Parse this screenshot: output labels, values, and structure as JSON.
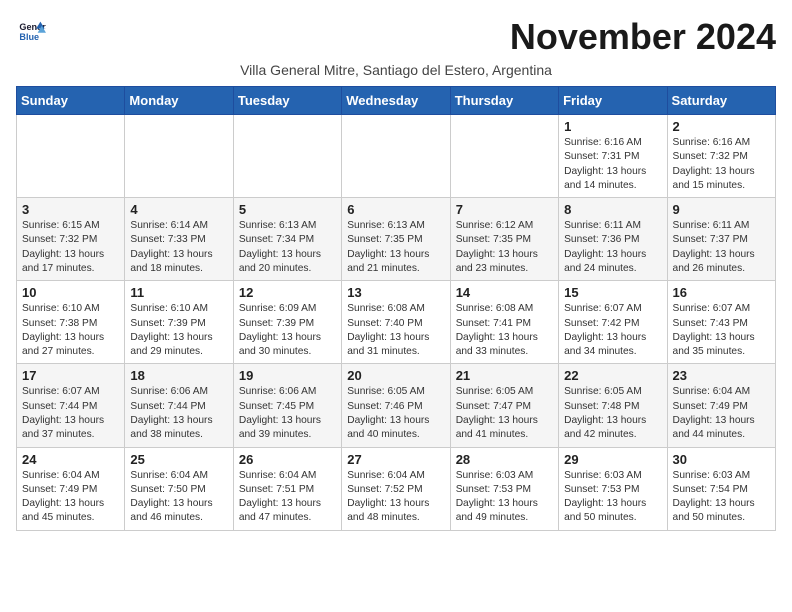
{
  "logo": {
    "line1": "General",
    "line2": "Blue"
  },
  "title": "November 2024",
  "subtitle": "Villa General Mitre, Santiago del Estero, Argentina",
  "days_of_week": [
    "Sunday",
    "Monday",
    "Tuesday",
    "Wednesday",
    "Thursday",
    "Friday",
    "Saturday"
  ],
  "weeks": [
    [
      {
        "day": "",
        "info": ""
      },
      {
        "day": "",
        "info": ""
      },
      {
        "day": "",
        "info": ""
      },
      {
        "day": "",
        "info": ""
      },
      {
        "day": "",
        "info": ""
      },
      {
        "day": "1",
        "info": "Sunrise: 6:16 AM\nSunset: 7:31 PM\nDaylight: 13 hours and 14 minutes."
      },
      {
        "day": "2",
        "info": "Sunrise: 6:16 AM\nSunset: 7:32 PM\nDaylight: 13 hours and 15 minutes."
      }
    ],
    [
      {
        "day": "3",
        "info": "Sunrise: 6:15 AM\nSunset: 7:32 PM\nDaylight: 13 hours and 17 minutes."
      },
      {
        "day": "4",
        "info": "Sunrise: 6:14 AM\nSunset: 7:33 PM\nDaylight: 13 hours and 18 minutes."
      },
      {
        "day": "5",
        "info": "Sunrise: 6:13 AM\nSunset: 7:34 PM\nDaylight: 13 hours and 20 minutes."
      },
      {
        "day": "6",
        "info": "Sunrise: 6:13 AM\nSunset: 7:35 PM\nDaylight: 13 hours and 21 minutes."
      },
      {
        "day": "7",
        "info": "Sunrise: 6:12 AM\nSunset: 7:35 PM\nDaylight: 13 hours and 23 minutes."
      },
      {
        "day": "8",
        "info": "Sunrise: 6:11 AM\nSunset: 7:36 PM\nDaylight: 13 hours and 24 minutes."
      },
      {
        "day": "9",
        "info": "Sunrise: 6:11 AM\nSunset: 7:37 PM\nDaylight: 13 hours and 26 minutes."
      }
    ],
    [
      {
        "day": "10",
        "info": "Sunrise: 6:10 AM\nSunset: 7:38 PM\nDaylight: 13 hours and 27 minutes."
      },
      {
        "day": "11",
        "info": "Sunrise: 6:10 AM\nSunset: 7:39 PM\nDaylight: 13 hours and 29 minutes."
      },
      {
        "day": "12",
        "info": "Sunrise: 6:09 AM\nSunset: 7:39 PM\nDaylight: 13 hours and 30 minutes."
      },
      {
        "day": "13",
        "info": "Sunrise: 6:08 AM\nSunset: 7:40 PM\nDaylight: 13 hours and 31 minutes."
      },
      {
        "day": "14",
        "info": "Sunrise: 6:08 AM\nSunset: 7:41 PM\nDaylight: 13 hours and 33 minutes."
      },
      {
        "day": "15",
        "info": "Sunrise: 6:07 AM\nSunset: 7:42 PM\nDaylight: 13 hours and 34 minutes."
      },
      {
        "day": "16",
        "info": "Sunrise: 6:07 AM\nSunset: 7:43 PM\nDaylight: 13 hours and 35 minutes."
      }
    ],
    [
      {
        "day": "17",
        "info": "Sunrise: 6:07 AM\nSunset: 7:44 PM\nDaylight: 13 hours and 37 minutes."
      },
      {
        "day": "18",
        "info": "Sunrise: 6:06 AM\nSunset: 7:44 PM\nDaylight: 13 hours and 38 minutes."
      },
      {
        "day": "19",
        "info": "Sunrise: 6:06 AM\nSunset: 7:45 PM\nDaylight: 13 hours and 39 minutes."
      },
      {
        "day": "20",
        "info": "Sunrise: 6:05 AM\nSunset: 7:46 PM\nDaylight: 13 hours and 40 minutes."
      },
      {
        "day": "21",
        "info": "Sunrise: 6:05 AM\nSunset: 7:47 PM\nDaylight: 13 hours and 41 minutes."
      },
      {
        "day": "22",
        "info": "Sunrise: 6:05 AM\nSunset: 7:48 PM\nDaylight: 13 hours and 42 minutes."
      },
      {
        "day": "23",
        "info": "Sunrise: 6:04 AM\nSunset: 7:49 PM\nDaylight: 13 hours and 44 minutes."
      }
    ],
    [
      {
        "day": "24",
        "info": "Sunrise: 6:04 AM\nSunset: 7:49 PM\nDaylight: 13 hours and 45 minutes."
      },
      {
        "day": "25",
        "info": "Sunrise: 6:04 AM\nSunset: 7:50 PM\nDaylight: 13 hours and 46 minutes."
      },
      {
        "day": "26",
        "info": "Sunrise: 6:04 AM\nSunset: 7:51 PM\nDaylight: 13 hours and 47 minutes."
      },
      {
        "day": "27",
        "info": "Sunrise: 6:04 AM\nSunset: 7:52 PM\nDaylight: 13 hours and 48 minutes."
      },
      {
        "day": "28",
        "info": "Sunrise: 6:03 AM\nSunset: 7:53 PM\nDaylight: 13 hours and 49 minutes."
      },
      {
        "day": "29",
        "info": "Sunrise: 6:03 AM\nSunset: 7:53 PM\nDaylight: 13 hours and 50 minutes."
      },
      {
        "day": "30",
        "info": "Sunrise: 6:03 AM\nSunset: 7:54 PM\nDaylight: 13 hours and 50 minutes."
      }
    ]
  ]
}
